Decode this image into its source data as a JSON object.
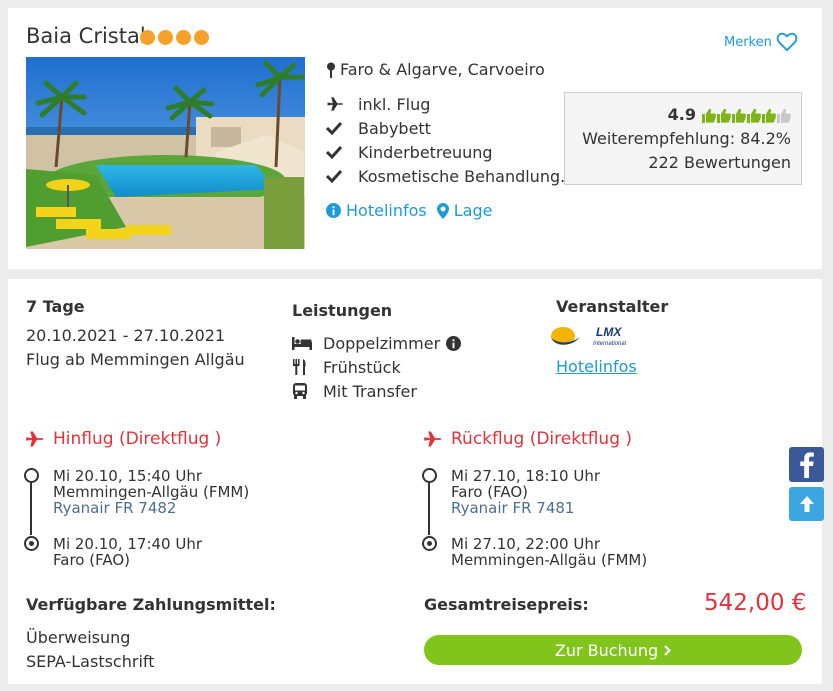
{
  "hotel": {
    "name": "Baia Cristal",
    "stars": 4,
    "star_color": "#f5a12a",
    "merken_label": "Merken",
    "location": "Faro & Algarve, Carvoeiro",
    "features": [
      {
        "icon": "plane-icon",
        "label": "inkl. Flug"
      },
      {
        "icon": "check-icon",
        "label": "Babybett"
      },
      {
        "icon": "check-icon",
        "label": "Kinderbetreuung"
      },
      {
        "icon": "check-icon",
        "label": "Kosmetische Behandlung..."
      }
    ],
    "links": {
      "hotelinfos": "Hotelinfos",
      "lage": "Lage"
    },
    "rating": {
      "value": "4.9",
      "thumbs_filled": 5,
      "thumbs_total": 6,
      "recommendation": "Weiterempfehlung: 84.2%",
      "reviews": "222 Bewertungen"
    }
  },
  "offer": {
    "duration": "7 Tage",
    "dates": "20.10.2021 - 27.10.2021",
    "departure": "Flug ab Memmingen Allgäu",
    "services_title": "Leistungen",
    "services": [
      {
        "icon": "bed-icon",
        "label": "Doppelzimmer"
      },
      {
        "icon": "cutlery-icon",
        "label": "Frühstück"
      },
      {
        "icon": "bus-icon",
        "label": "Mit Transfer"
      }
    ],
    "operator_title": "Veranstalter",
    "operator_logo_text": "LMX",
    "operator_logo_sub": "International",
    "operator_link": "Hotelinfos"
  },
  "flights": {
    "outbound": {
      "title": "Hinflug (Direktflug )",
      "dep": {
        "time": "Mi 20.10, 15:40 Uhr",
        "airport": "Memmingen-Allgäu (FMM)",
        "flight": "Ryanair FR 7482"
      },
      "arr": {
        "time": "Mi 20.10, 17:40 Uhr",
        "airport": "Faro (FAO)"
      }
    },
    "inbound": {
      "title": "Rückflug (Direktflug )",
      "dep": {
        "time": "Mi 27.10, 18:10 Uhr",
        "airport": "Faro (FAO)",
        "flight": "Ryanair FR 7481"
      },
      "arr": {
        "time": "Mi 27.10, 22:00 Uhr",
        "airport": "Memmingen-Allgäu (FMM)"
      }
    }
  },
  "payment": {
    "title": "Verfügbare Zahlungsmittel:",
    "methods": [
      "Überweisung",
      "SEPA-Lastschrift"
    ]
  },
  "price": {
    "label": "Gesamtreisepreis:",
    "value": "542,00 €",
    "color": "#e2323a"
  },
  "booking": {
    "label": "Zur Buchung"
  },
  "colors": {
    "accent_blue": "#1e9ad6",
    "book_green": "#80c41c",
    "rating_green": "#7cb518"
  }
}
